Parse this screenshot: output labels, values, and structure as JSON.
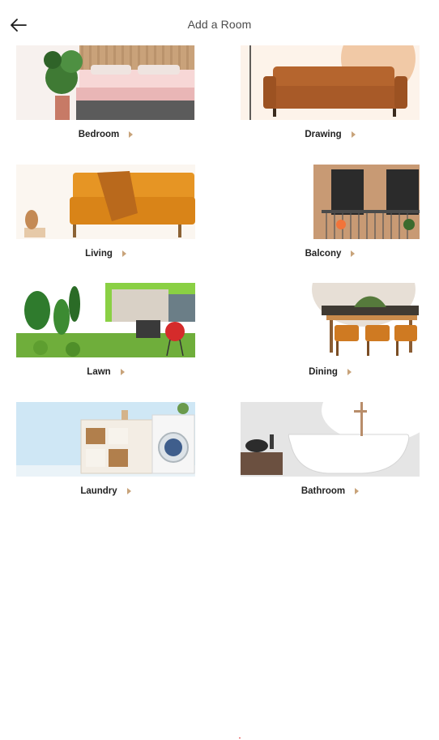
{
  "header": {
    "title": "Add a Room",
    "back_icon": "arrow-left-icon"
  },
  "rooms": [
    {
      "label": "Bedroom",
      "image": "bedroom-photo"
    },
    {
      "label": "Drawing",
      "image": "sofa-photo"
    },
    {
      "label": "Living",
      "image": "living-sofa-photo"
    },
    {
      "label": "Balcony",
      "image": "balcony-photo"
    },
    {
      "label": "Lawn",
      "image": "lawn-photo"
    },
    {
      "label": "Dining",
      "image": "dining-photo"
    },
    {
      "label": "Laundry",
      "image": "laundry-photo"
    },
    {
      "label": "Bathroom",
      "image": "bathtub-photo"
    }
  ],
  "colors": {
    "accent": "#c8a37a",
    "text": "#232323",
    "title": "#4b4b4b"
  }
}
